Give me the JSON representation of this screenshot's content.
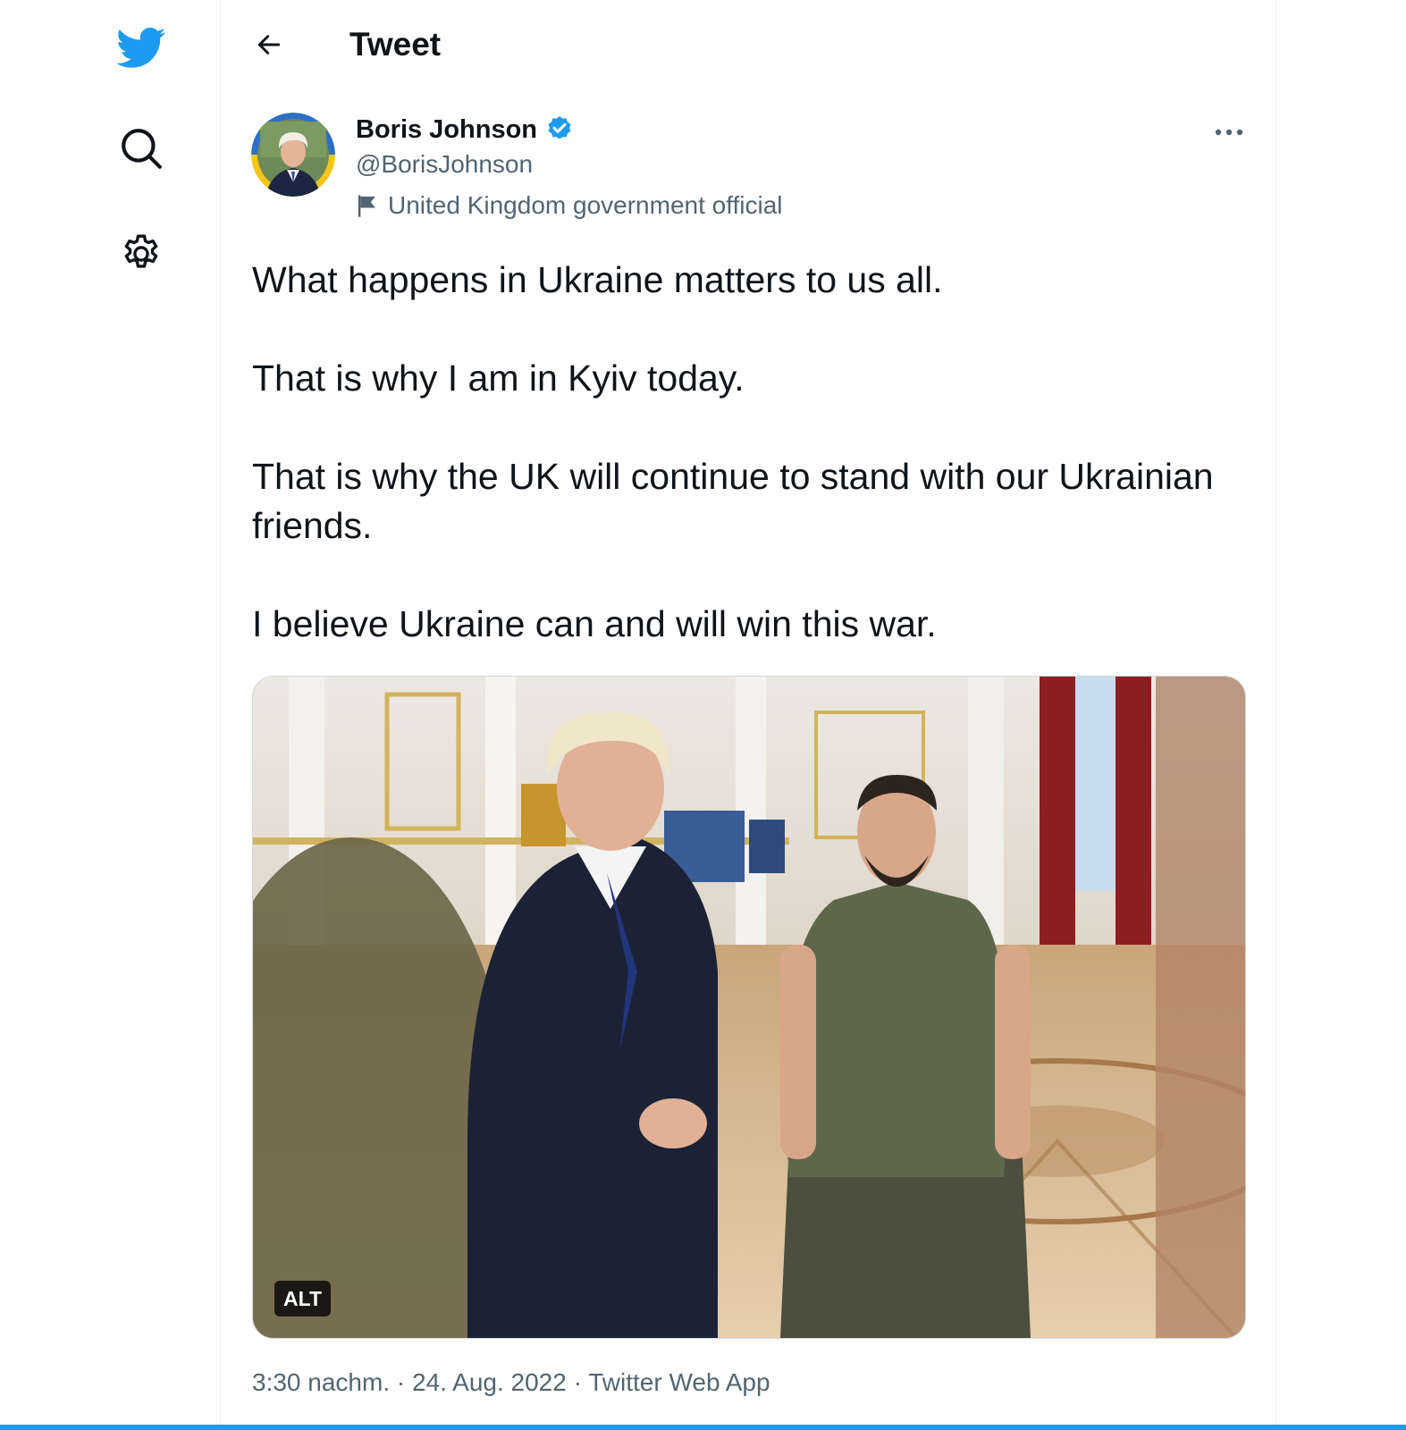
{
  "nav": {
    "icons": [
      "twitter-bird-icon",
      "search-icon",
      "settings-gear-icon"
    ]
  },
  "header": {
    "title": "Tweet"
  },
  "tweet": {
    "author_name": "Boris Johnson",
    "handle": "@BorisJohnson",
    "label": "United Kingdom government official",
    "paragraphs": [
      "What happens in Ukraine matters to us all.",
      "That is why I am in Kyiv today.",
      "That is why the UK will continue to stand with our Ukrainian friends.",
      "I believe Ukraine can and will win this war."
    ],
    "media_alt_badge": "ALT",
    "time": "3:30 nachm.",
    "separator": "·",
    "date": "24. Aug. 2022",
    "source": "Twitter Web App"
  },
  "colors": {
    "accent": "#1d9bf0",
    "text_primary": "#0f1419",
    "text_secondary": "#536471",
    "verified": "#1d9bf0"
  }
}
